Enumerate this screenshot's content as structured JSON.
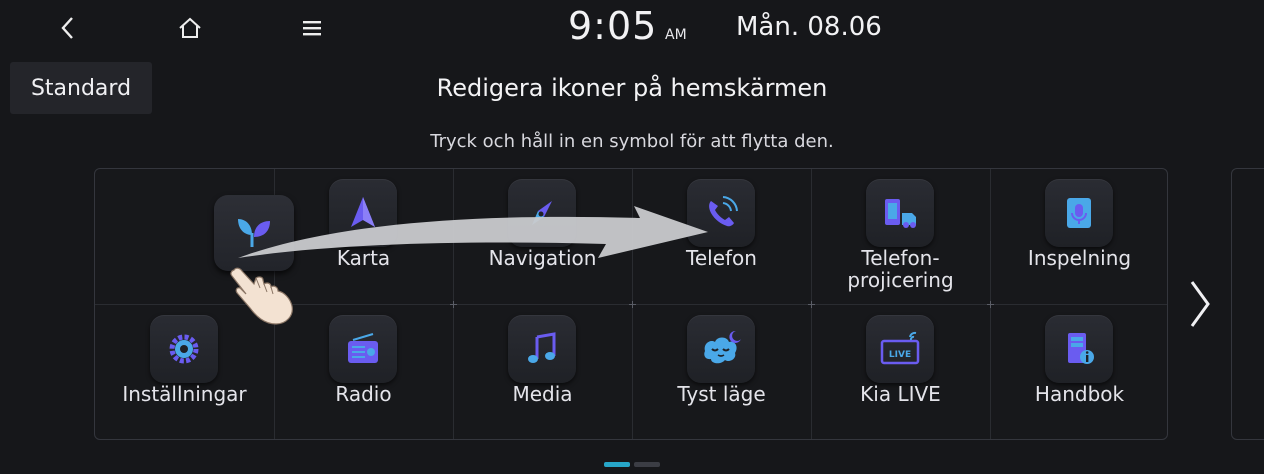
{
  "topbar": {
    "back_icon": "back-chevron-icon",
    "home_icon": "home-icon",
    "menu_icon": "menu-icon",
    "time": "9:05",
    "ampm": "AM",
    "date": "Mån. 08.06"
  },
  "header": {
    "standard_label": "Standard",
    "title": "Redigera ikoner på hemskärmen",
    "instruction": "Tryck och håll in en symbol för att flytta den."
  },
  "tiles": [
    {
      "label": "Karta",
      "icon": "map-arrow-icon"
    },
    {
      "label": "Navigation",
      "icon": "compass-icon"
    },
    {
      "label": "Telefon",
      "icon": "phone-icon"
    },
    {
      "label": "Telefon-\nprojicering",
      "icon": "phone-projection-icon"
    },
    {
      "label": "Inspelning",
      "icon": "recorder-icon"
    },
    {
      "label": "Inställningar",
      "icon": "gear-icon"
    },
    {
      "label": "Radio",
      "icon": "radio-icon"
    },
    {
      "label": "Media",
      "icon": "music-note-icon"
    },
    {
      "label": "Tyst läge",
      "icon": "quiet-mode-icon"
    },
    {
      "label": "Kia LIVE",
      "icon": "kia-live-icon"
    },
    {
      "label": "Handbok",
      "icon": "manual-icon"
    }
  ],
  "drag": {
    "icon": "sprout-icon"
  },
  "pagination": {
    "pages": 2,
    "current": 1
  },
  "colors": {
    "accent": "#27a6c8",
    "icon_purple": "#6a5cf0",
    "icon_blue": "#4aa8e8"
  }
}
